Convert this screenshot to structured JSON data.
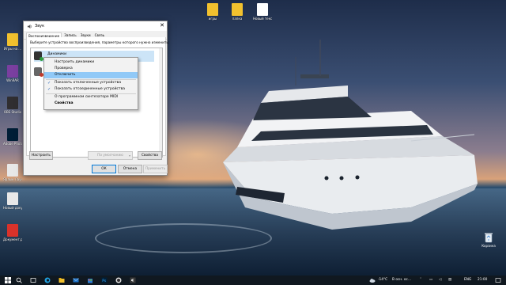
{
  "desktop": {
    "left_icons": [
      {
        "label": "Игры на ...",
        "icon": "game-icon",
        "color": "#f2c12e"
      },
      {
        "label": "WinRAR",
        "icon": "winrar-icon",
        "color": "#7a3fa0"
      },
      {
        "label": "OBS Studio",
        "icon": "obs-icon",
        "color": "#302e31"
      },
      {
        "label": "Adobe Photoshop",
        "icon": "photoshop-icon",
        "color": "#001e36"
      },
      {
        "label": "Ярлык Лаунч...",
        "icon": "shortcut-icon",
        "color": "#e8e8e8"
      },
      {
        "label": "Новый документ",
        "icon": "docx-icon",
        "color": "#e8e8e8"
      },
      {
        "label": "Документ.pdf",
        "icon": "pdf-icon",
        "color": "#d9322a"
      }
    ],
    "top_icons": [
      {
        "label": "игры",
        "icon": "folder-icon",
        "color": "#f2c12e"
      },
      {
        "label": "папка",
        "icon": "folder-icon",
        "color": "#f2c12e"
      },
      {
        "label": "Новый текстовый...",
        "icon": "text-file-icon",
        "color": "#ffffff"
      }
    ],
    "recycle_bin_label": "Корзина"
  },
  "dialog": {
    "title": "Звук",
    "close_glyph": "✕",
    "tabs": [
      "Воспроизведение",
      "Запись",
      "Звуки",
      "Связь"
    ],
    "instruction": "Выберите устройство воспроизведения, параметры которого нужно изменить:",
    "devices": [
      {
        "name": "Динамики",
        "status": "default",
        "badge_color": "#2e9e3f"
      },
      {
        "name": "",
        "status": "disabled",
        "badge_color": "#c0392b"
      }
    ],
    "buttons": {
      "configure": "Настроить",
      "set_default": "По умолчанию",
      "properties": "Свойства",
      "ok": "ОК",
      "cancel": "Отмена",
      "apply": "Применить"
    }
  },
  "context_menu": {
    "items": [
      {
        "label": "Настроить динамики",
        "checked": false,
        "highlighted": false,
        "bold": false
      },
      {
        "label": "Проверка",
        "checked": false,
        "highlighted": false,
        "bold": false
      },
      {
        "label": "Отключить",
        "checked": false,
        "highlighted": true,
        "bold": false
      },
      {
        "label": "Показать отключенные устройства",
        "checked": true,
        "highlighted": false,
        "bold": false
      },
      {
        "label": "Показать отсоединенные устройства",
        "checked": true,
        "highlighted": false,
        "bold": false
      },
      {
        "label": "О программном синтезаторе MIDI",
        "checked": false,
        "highlighted": false,
        "bold": false
      },
      {
        "label": "Свойства",
        "checked": false,
        "highlighted": false,
        "bold": true
      }
    ]
  },
  "taskbar": {
    "weather": "-14°C",
    "weather_desc": "В осн. ос...",
    "language": "ENG",
    "time": "21:00"
  }
}
